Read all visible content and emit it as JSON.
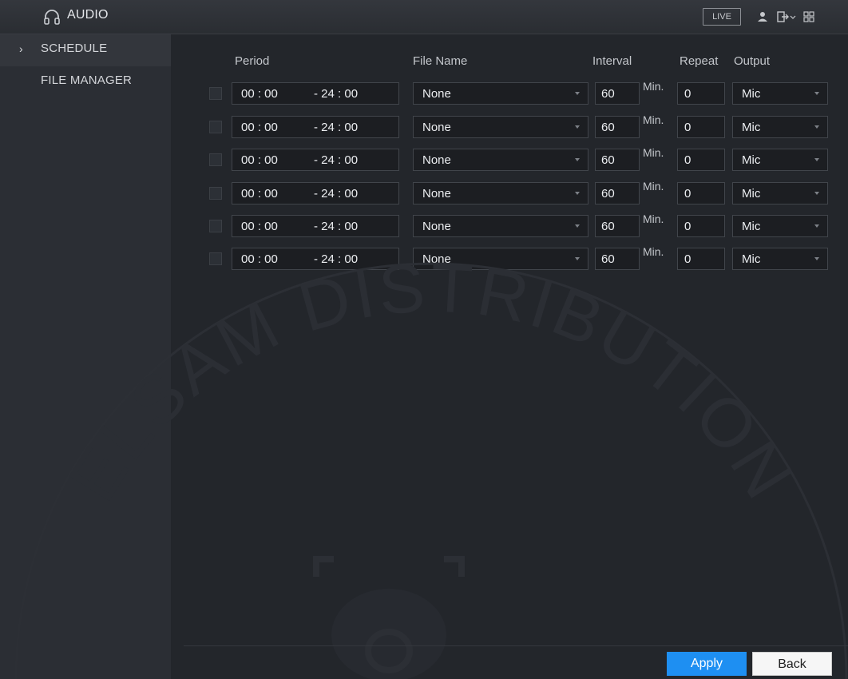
{
  "titlebar": {
    "title": "AUDIO",
    "live_label": "LIVE",
    "icons": [
      "headphones-icon",
      "user-icon",
      "logout-icon",
      "grid-icon"
    ]
  },
  "sidebar": {
    "items": [
      {
        "label": "SCHEDULE",
        "active": true,
        "arrow": "›"
      },
      {
        "label": "FILE MANAGER",
        "active": false
      }
    ]
  },
  "table": {
    "headers": {
      "period": "Period",
      "file_name": "File Name",
      "interval": "Interval",
      "repeat": "Repeat",
      "output": "Output"
    },
    "rows": [
      {
        "start": "00 : 00",
        "end": "- 24 : 00",
        "file": "None",
        "interval": "60",
        "unit": "Min.",
        "repeat": "0",
        "output": "Mic"
      },
      {
        "start": "00 : 00",
        "end": "- 24 : 00",
        "file": "None",
        "interval": "60",
        "unit": "Min.",
        "repeat": "0",
        "output": "Mic"
      },
      {
        "start": "00 : 00",
        "end": "- 24 : 00",
        "file": "None",
        "interval": "60",
        "unit": "Min.",
        "repeat": "0",
        "output": "Mic"
      },
      {
        "start": "00 : 00",
        "end": "- 24 : 00",
        "file": "None",
        "interval": "60",
        "unit": "Min.",
        "repeat": "0",
        "output": "Mic"
      },
      {
        "start": "00 : 00",
        "end": "- 24 : 00",
        "file": "None",
        "interval": "60",
        "unit": "Min.",
        "repeat": "0",
        "output": "Mic"
      },
      {
        "start": "00 : 00",
        "end": "- 24 : 00",
        "file": "None",
        "interval": "60",
        "unit": "Min.",
        "repeat": "0",
        "output": "Mic"
      }
    ]
  },
  "watermark": {
    "text": "ELSAM DISTRIBUTION"
  },
  "footer": {
    "apply_label": "Apply",
    "back_label": "Back"
  },
  "colors": {
    "accent": "#1e8ff2",
    "background": "#23262b",
    "sidebar": "#2b2e34"
  }
}
